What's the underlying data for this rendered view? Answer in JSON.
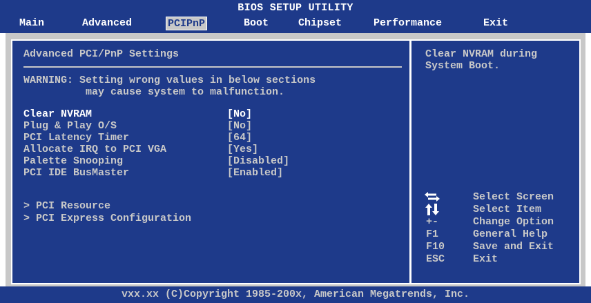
{
  "header": {
    "title": "BIOS SETUP UTILITY",
    "tabs": [
      {
        "label": "Main",
        "active": false
      },
      {
        "label": "Advanced",
        "active": false
      },
      {
        "label": "PCIPnP",
        "active": true
      },
      {
        "label": "Boot",
        "active": false
      },
      {
        "label": "Chipset",
        "active": false
      },
      {
        "label": "Performance",
        "active": false
      },
      {
        "label": "Exit",
        "active": false
      }
    ]
  },
  "main": {
    "section_title": "Advanced PCI/PnP Settings",
    "warning_line1": "WARNING: Setting wrong values in below sections",
    "warning_line2": "may cause system to malfunction.",
    "settings": [
      {
        "label": "Clear NVRAM",
        "value": "[No]",
        "selected": true
      },
      {
        "label": "Plug & Play O/S",
        "value": "[No]",
        "selected": false
      },
      {
        "label": "PCI Latency Timer",
        "value": "[64]",
        "selected": false
      },
      {
        "label": "Allocate IRQ to PCI VGA",
        "value": "[Yes]",
        "selected": false
      },
      {
        "label": "Palette Snooping",
        "value": "[Disabled]",
        "selected": false
      },
      {
        "label": "PCI IDE BusMaster",
        "value": "[Enabled]",
        "selected": false
      }
    ],
    "submenus": [
      {
        "label": "> PCI Resource"
      },
      {
        "label": "> PCI Express Configuration"
      }
    ]
  },
  "help": {
    "line1": "Clear NVRAM during",
    "line2": "System Boot."
  },
  "keys": [
    {
      "key": "left-right-arrows-icon",
      "action": "Select Screen"
    },
    {
      "key": "up-down-arrows-icon",
      "action": "Select Item"
    },
    {
      "key": "+-",
      "action": "Change Option"
    },
    {
      "key": "F1",
      "action": "General Help"
    },
    {
      "key": "F10",
      "action": "Save and Exit"
    },
    {
      "key": "ESC",
      "action": "Exit"
    }
  ],
  "footer": {
    "text": "vxx.xx (C)Copyright 1985-200x, American Megatrends, Inc."
  },
  "colors": {
    "background": "#1e3a8a",
    "text": "#c8c8c8",
    "highlight": "#ffffff"
  }
}
